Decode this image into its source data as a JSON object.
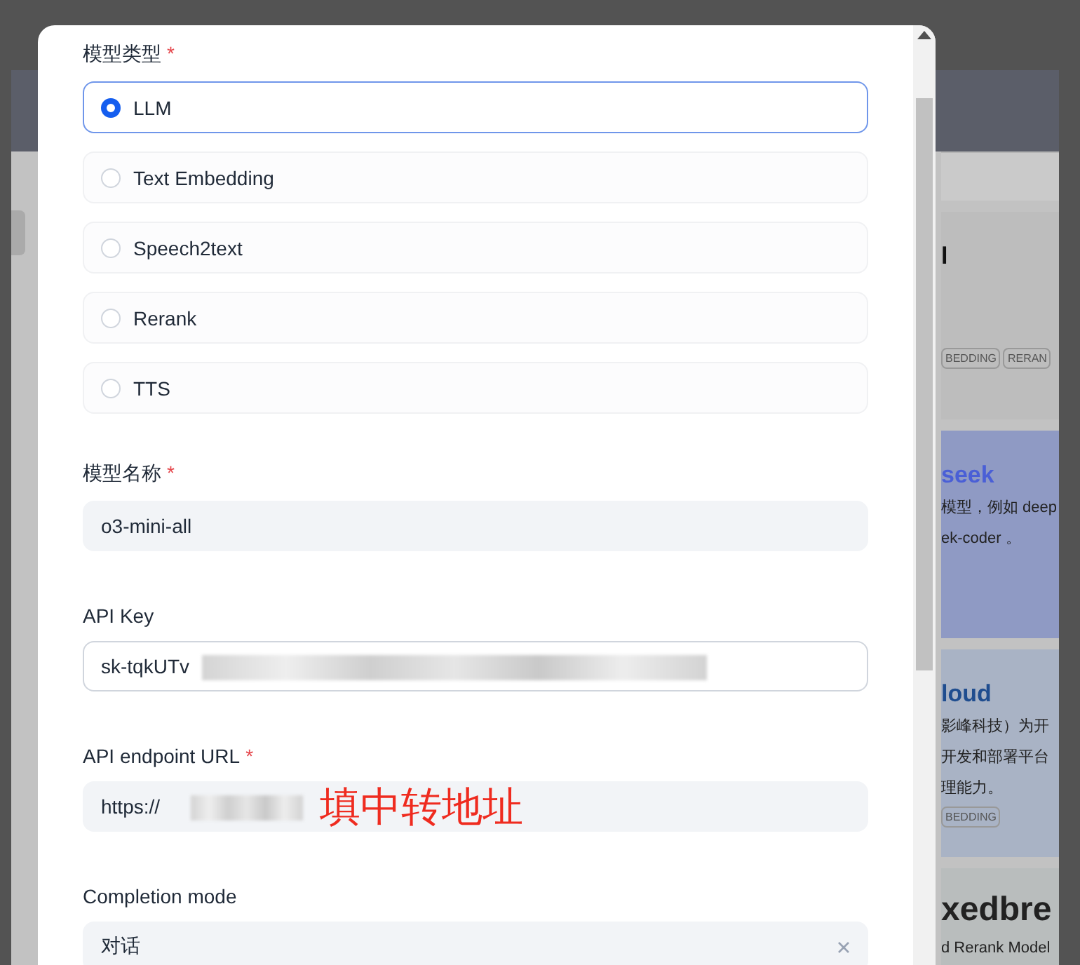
{
  "dialog": {
    "model_type": {
      "label": "模型类型",
      "required_mark": "*",
      "options": [
        {
          "label": "LLM",
          "selected": true
        },
        {
          "label": "Text Embedding",
          "selected": false
        },
        {
          "label": "Speech2text",
          "selected": false
        },
        {
          "label": "Rerank",
          "selected": false
        },
        {
          "label": "TTS",
          "selected": false
        }
      ]
    },
    "fields": [
      {
        "kind": "input",
        "label": "模型名称",
        "required_mark": "*",
        "value": "o3-mini-all"
      },
      {
        "kind": "input",
        "label": "API Key",
        "value": "sk-tqkUTv",
        "redacted": true,
        "bordered": true
      },
      {
        "kind": "input",
        "label": "API endpoint URL",
        "required_mark": "*",
        "value": "https://",
        "redacted": true,
        "annotation": "填中转地址"
      },
      {
        "kind": "select",
        "label": "Completion mode",
        "value": "对话",
        "clearable": true
      }
    ]
  },
  "background_cards": [
    {
      "title": "l",
      "tags": [
        "BEDDING",
        "RERAN"
      ]
    },
    {
      "title": "seek",
      "lines": [
        "模型，例如 deep",
        "ek-coder 。"
      ]
    },
    {
      "title": "loud",
      "lines": [
        "影峰科技）为开",
        "开发和部署平台",
        "理能力。"
      ],
      "tags": [
        "BEDDING"
      ]
    },
    {
      "title": "xedbre",
      "lines": [
        "d Rerank Model"
      ]
    }
  ]
}
